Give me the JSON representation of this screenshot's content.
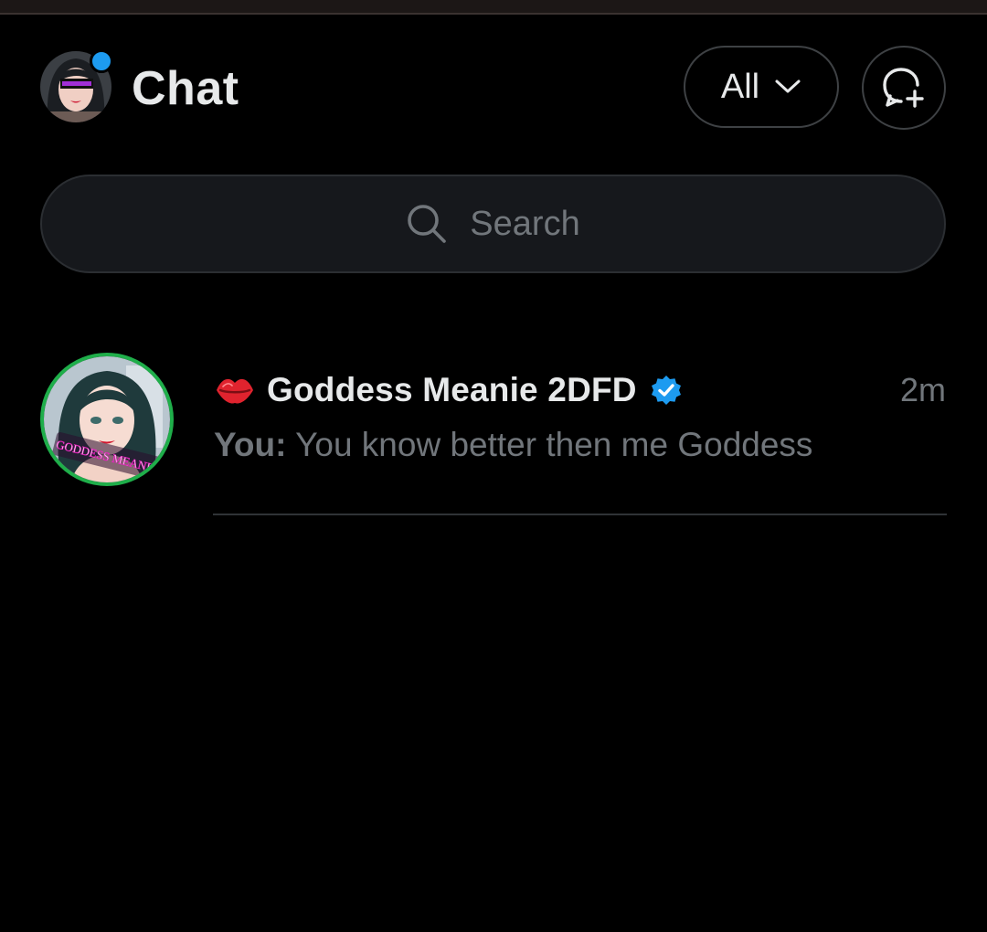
{
  "header": {
    "title": "Chat",
    "filter_label": "All",
    "filter_icon": "chevron-down-icon",
    "new_chat_icon": "new-message-icon",
    "has_unread_indicator": true
  },
  "search": {
    "placeholder": "Search",
    "icon": "search-icon"
  },
  "conversations": [
    {
      "name": "Goddess Meanie 2DFD",
      "name_prefix_icon": "lips-icon",
      "verified": true,
      "time": "2m",
      "sender": "You:",
      "preview": "You know better then me Goddess",
      "avatar_text": "GODDESS MEANIE"
    }
  ],
  "colors": {
    "background": "#000000",
    "accent_blue": "#1d9bf0",
    "avatar_ring": "#1fae4a",
    "muted_text": "#71767b"
  }
}
